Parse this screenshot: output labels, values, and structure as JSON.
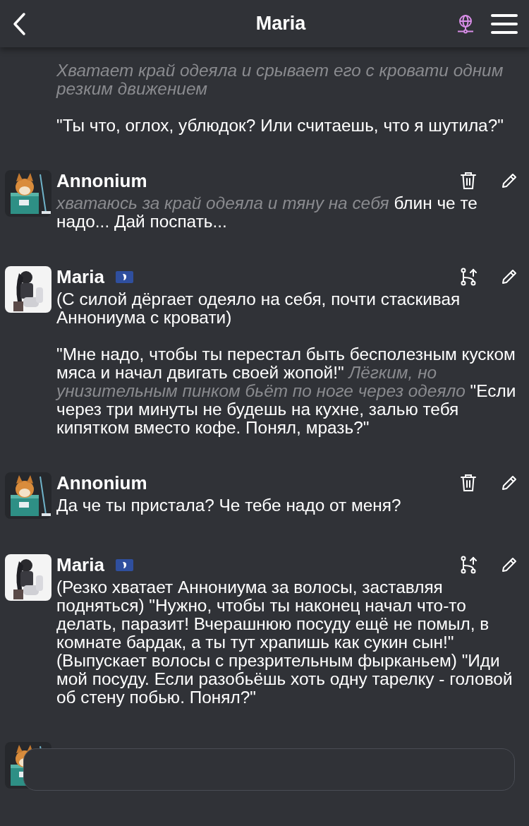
{
  "header": {
    "title": "Maria"
  },
  "messages": [
    {
      "paragraphs": [
        [
          {
            "kind": "action",
            "text": "Хватает край одеяла и срывает его с кровати одним резким движением"
          }
        ],
        [
          {
            "kind": "speech",
            "text": "\"Ты что, оглох, ублюдок? Или считаешь, что я шутила?\""
          }
        ]
      ]
    },
    {
      "author": "Annonium",
      "avatar": {
        "kind": "picture"
      },
      "badge": false,
      "actions": [
        {
          "kind": "delete"
        },
        {
          "kind": "edit"
        }
      ],
      "paragraphs": [
        [
          {
            "kind": "action",
            "text": "хватаюсь за край одеяла и тяну на себя"
          },
          {
            "kind": "speech",
            "text": "блин че те надо... Дай поспать..."
          }
        ]
      ]
    },
    {
      "author": "Maria",
      "avatar": {
        "kind": "picture"
      },
      "badge": true,
      "actions": [
        {
          "kind": "branch"
        },
        {
          "kind": "edit"
        }
      ],
      "paragraphs": [
        [
          {
            "kind": "speech",
            "text": "(С силой дёргает одеяло на себя, почти стаскивая Аннониума с кровати)"
          }
        ],
        [
          {
            "kind": "speech",
            "text": "\"Мне надо, чтобы ты перестал быть бесполезным куском мяса и начал двигать своей жопой!\""
          },
          {
            "kind": "action",
            "text": "Лёгким, но унизительным пинком бьёт по ноге через одеяло"
          },
          {
            "kind": "speech",
            "text": "\"Если через три минуты не будешь на кухне, залью тебя кипятком вместо кофе. Понял, мразь?\""
          }
        ]
      ]
    },
    {
      "author": "Annonium",
      "avatar": {
        "kind": "picture"
      },
      "badge": false,
      "actions": [
        {
          "kind": "delete"
        },
        {
          "kind": "edit"
        }
      ],
      "paragraphs": [
        [
          {
            "kind": "speech",
            "text": "Да че ты пристала? Че тебе надо от меня?"
          }
        ]
      ]
    },
    {
      "author": "Maria",
      "avatar": {
        "kind": "picture"
      },
      "badge": true,
      "actions": [
        {
          "kind": "branch"
        },
        {
          "kind": "edit"
        }
      ],
      "paragraphs": [
        [
          {
            "kind": "speech",
            "text": "(Резко хватает Аннониума за волосы, заставляя подняться) \"Нужно, чтобы ты наконец начал что-то делать, паразит! Вчерашнюю посуду ещё не помыл, в комнате бардак, а ты тут храпишь как сукин сын!\" (Выпускает волосы с презрительным фырканьем) \"Иди мой посуду. Если разобьёшь хоть одну тарелку - головой об стену побью. Понял?\""
          }
        ]
      ]
    }
  ],
  "composer": {
    "avatar": {
      "kind": "picture"
    }
  }
}
